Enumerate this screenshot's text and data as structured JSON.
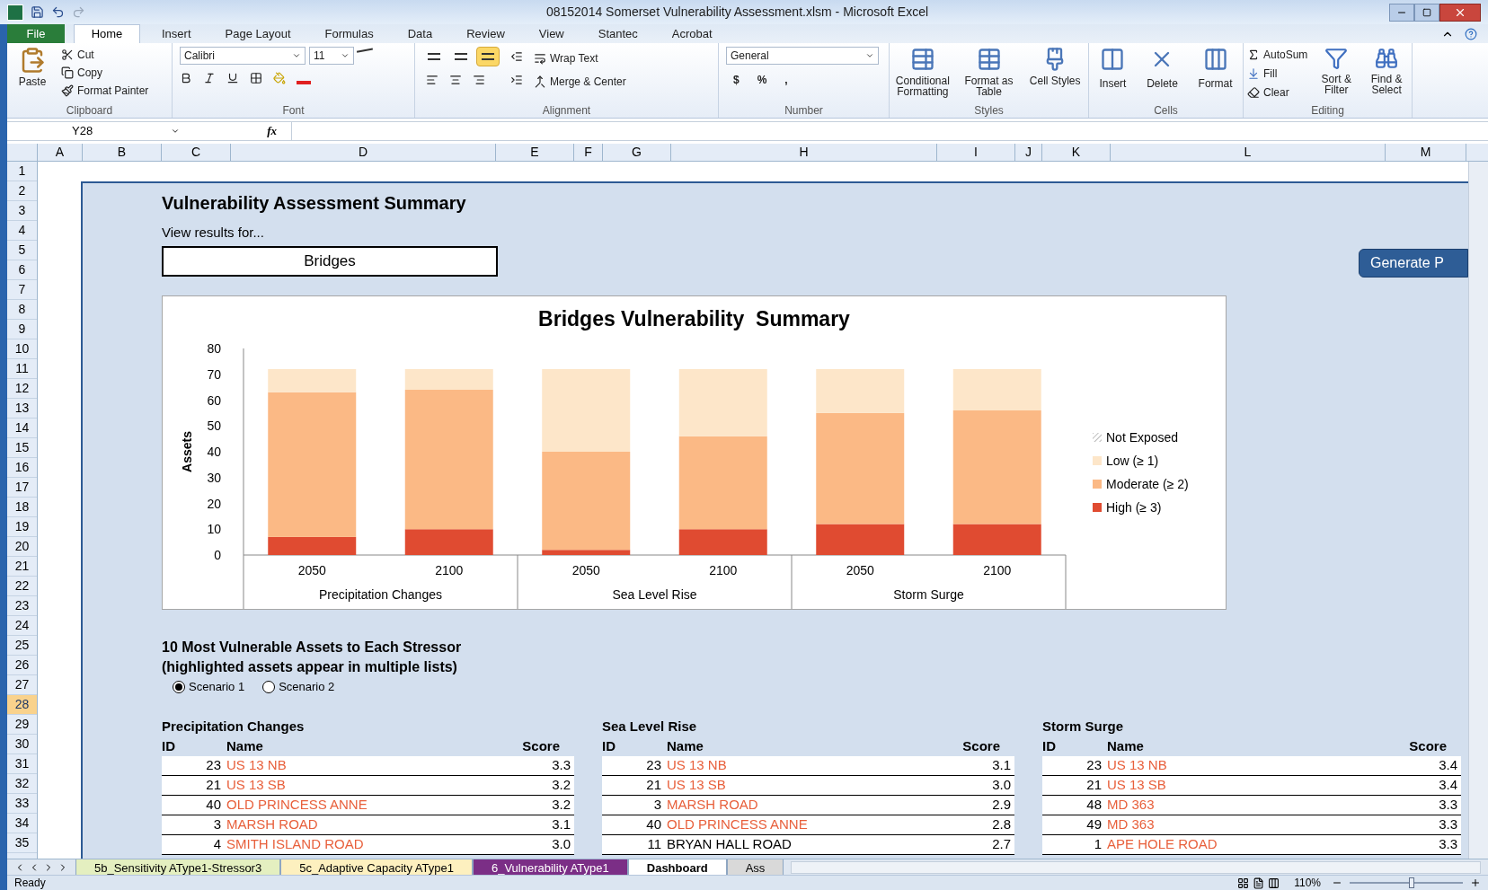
{
  "window": {
    "title": "08152014 Somerset Vulnerability Assessment.xlsm  -  Microsoft Excel"
  },
  "ribbon_tabs": [
    {
      "label": "File",
      "selected": false,
      "kind": "file"
    },
    {
      "label": "Home",
      "selected": true,
      "kind": "tab"
    },
    {
      "label": "Insert",
      "selected": false,
      "kind": "tab"
    },
    {
      "label": "Page Layout",
      "selected": false,
      "kind": "tab"
    },
    {
      "label": "Formulas",
      "selected": false,
      "kind": "tab"
    },
    {
      "label": "Data",
      "selected": false,
      "kind": "tab"
    },
    {
      "label": "Review",
      "selected": false,
      "kind": "tab"
    },
    {
      "label": "View",
      "selected": false,
      "kind": "tab"
    },
    {
      "label": "Stantec",
      "selected": false,
      "kind": "tab"
    },
    {
      "label": "Acrobat",
      "selected": false,
      "kind": "tab"
    }
  ],
  "ribbon": {
    "clipboard": {
      "paste": "Paste",
      "cut": "Cut",
      "copy": "Copy",
      "format_painter": "Format Painter",
      "label": "Clipboard"
    },
    "font": {
      "font_name": "Calibri",
      "font_size": "11",
      "label": "Font"
    },
    "alignment": {
      "vertical_align": [
        {
          "selected": false
        },
        {
          "selected": false
        },
        {
          "selected": true
        }
      ],
      "wrap_text": "Wrap Text",
      "merge_center": "Merge & Center",
      "label": "Alignment"
    },
    "number": {
      "format": "General",
      "symbols": [
        "$",
        "%",
        ","
      ],
      "label": "Number"
    },
    "styles": {
      "buttons": [
        "Conditional Formatting",
        "Format as Table",
        "Cell Styles"
      ],
      "label": "Styles"
    },
    "cells": {
      "buttons": [
        "Insert",
        "Delete",
        "Format"
      ],
      "label": "Cells"
    },
    "editing": {
      "autosum": "AutoSum",
      "fill": "Fill",
      "clear": "Clear",
      "buttons": [
        "Sort & Filter",
        "Find & Select"
      ],
      "label": "Editing"
    }
  },
  "formula_bar": {
    "name_box": "Y28",
    "fx": "fx"
  },
  "columns": [
    "A",
    "B",
    "C",
    "D",
    "E",
    "F",
    "G",
    "H",
    "I",
    "J",
    "K",
    "L",
    "M"
  ],
  "row_headers": [
    {
      "label": "1",
      "selected": false
    },
    {
      "label": "2",
      "selected": false
    },
    {
      "label": "3",
      "selected": false
    },
    {
      "label": "4",
      "selected": false
    },
    {
      "label": "5",
      "selected": false
    },
    {
      "label": "6",
      "selected": false
    },
    {
      "label": "7",
      "selected": false
    },
    {
      "label": "8",
      "selected": false
    },
    {
      "label": "9",
      "selected": false
    },
    {
      "label": "10",
      "selected": false
    },
    {
      "label": "11",
      "selected": false
    },
    {
      "label": "12",
      "selected": false
    },
    {
      "label": "13",
      "selected": false
    },
    {
      "label": "14",
      "selected": false
    },
    {
      "label": "15",
      "selected": false
    },
    {
      "label": "16",
      "selected": false
    },
    {
      "label": "17",
      "selected": false
    },
    {
      "label": "18",
      "selected": false
    },
    {
      "label": "19",
      "selected": false
    },
    {
      "label": "20",
      "selected": false
    },
    {
      "label": "21",
      "selected": false
    },
    {
      "label": "22",
      "selected": false
    },
    {
      "label": "23",
      "selected": false
    },
    {
      "label": "24",
      "selected": false
    },
    {
      "label": "25",
      "selected": false
    },
    {
      "label": "26",
      "selected": false
    },
    {
      "label": "27",
      "selected": false
    },
    {
      "label": "28",
      "selected": true
    },
    {
      "label": "29",
      "selected": false
    },
    {
      "label": "30",
      "selected": false
    },
    {
      "label": "31",
      "selected": false
    },
    {
      "label": "32",
      "selected": false
    },
    {
      "label": "33",
      "selected": false
    },
    {
      "label": "34",
      "selected": false
    },
    {
      "label": "35",
      "selected": false
    }
  ],
  "dashboard": {
    "title": "Vulnerability Assessment Summary",
    "view_label": "View results for...",
    "view_value": "Bridges",
    "generate_button": "Generate P",
    "chart": {
      "chart_data": {
        "type": "bar",
        "stacked": true,
        "title": "Bridges Vulnerability  Summary",
        "ylabel": "Assets",
        "categories": [
          "2050",
          "2100",
          "2050",
          "2100",
          "2050",
          "2100"
        ],
        "annotations": [
          {
            "text": "Precipitation Changes"
          },
          {
            "text": "Sea Level Rise"
          },
          {
            "text": "Storm Surge"
          }
        ],
        "legend": true,
        "ylim": [
          0,
          80
        ],
        "yticks": [
          {
            "value": 0,
            "label": "0"
          },
          {
            "value": 10,
            "label": "10"
          },
          {
            "value": 20,
            "label": "20"
          },
          {
            "value": 30,
            "label": "30"
          },
          {
            "value": 40,
            "label": "40"
          },
          {
            "value": 50,
            "label": "50"
          },
          {
            "value": 60,
            "label": "60"
          },
          {
            "value": 70,
            "label": "70"
          },
          {
            "value": 80,
            "label": "80"
          }
        ],
        "series": [
          {
            "name": "High (≥ 3)",
            "color": "#e04b31",
            "values": [
              7,
              10,
              2,
              10,
              12,
              12
            ]
          },
          {
            "name": "Moderate (≥ 2)",
            "color": "#fbb985",
            "values": [
              56,
              54,
              38,
              36,
              43,
              44
            ]
          },
          {
            "name": "Low (≥ 1)",
            "color": "#fde6c9",
            "values": [
              9,
              8,
              32,
              26,
              17,
              16
            ]
          },
          {
            "name": "Not Exposed",
            "color": "#a6a6a6",
            "values": [
              0,
              0,
              0,
              0,
              0,
              0
            ]
          }
        ]
      }
    },
    "list_heading": "10 Most Vulnerable Assets to Each Stressor",
    "list_subheading": "(highlighted assets appear in multiple lists)",
    "scenarios": [
      {
        "label": "Scenario 1",
        "selected": true
      },
      {
        "label": "Scenario 2",
        "selected": false
      }
    ],
    "tables": [
      {
        "title": "Precipitation Changes",
        "columns": [
          "ID",
          "Name",
          "Score"
        ],
        "rows": [
          {
            "number": "23",
            "name": "US 13 NB",
            "score": "3.3",
            "highlighted": true
          },
          {
            "number": "21",
            "name": "US 13 SB",
            "score": "3.2",
            "highlighted": true
          },
          {
            "number": "40",
            "name": "OLD PRINCESS ANNE",
            "score": "3.2",
            "highlighted": true
          },
          {
            "number": "3",
            "name": "MARSH ROAD",
            "score": "3.1",
            "highlighted": true
          },
          {
            "number": "4",
            "name": "SMITH ISLAND ROAD",
            "score": "3.0",
            "highlighted": true
          }
        ]
      },
      {
        "title": "Sea Level Rise",
        "columns": [
          "ID",
          "Name",
          "Score"
        ],
        "rows": [
          {
            "number": "23",
            "name": "US 13 NB",
            "score": "3.1",
            "highlighted": true
          },
          {
            "number": "21",
            "name": "US 13 SB",
            "score": "3.0",
            "highlighted": true
          },
          {
            "number": "3",
            "name": "MARSH ROAD",
            "score": "2.9",
            "highlighted": true
          },
          {
            "number": "40",
            "name": "OLD PRINCESS ANNE",
            "score": "2.8",
            "highlighted": true
          },
          {
            "number": "11",
            "name": "BRYAN HALL ROAD",
            "score": "2.7",
            "highlighted": false
          }
        ]
      },
      {
        "title": "Storm Surge",
        "columns": [
          "ID",
          "Name",
          "Score"
        ],
        "rows": [
          {
            "number": "23",
            "name": "US 13 NB",
            "score": "3.4",
            "highlighted": true
          },
          {
            "number": "21",
            "name": "US 13 SB",
            "score": "3.4",
            "highlighted": true
          },
          {
            "number": "48",
            "name": "MD 363",
            "score": "3.3",
            "highlighted": true
          },
          {
            "number": "49",
            "name": "MD 363",
            "score": "3.3",
            "highlighted": true
          },
          {
            "number": "1",
            "name": "APE HOLE ROAD",
            "score": "3.3",
            "highlighted": true
          }
        ]
      }
    ]
  },
  "sheet_tabs": [
    {
      "label": "5b_Sensitivity AType1-Stressor3",
      "selected": false,
      "color": "#e4efc0"
    },
    {
      "label": "5c_Adaptive Capacity AType1",
      "selected": false,
      "color": "#fdf0bf"
    },
    {
      "label": "6_Vulnerability AType1",
      "selected": false,
      "color": "#7b2e86"
    },
    {
      "label": "Dashboard",
      "selected": true,
      "color": "#ffffff"
    },
    {
      "label": "Ass",
      "selected": false,
      "color": "#d9d9d9"
    }
  ],
  "status_bar": {
    "status": "Ready",
    "zoom": "110%",
    "zoom_slider": {
      "level": 0.55
    }
  }
}
